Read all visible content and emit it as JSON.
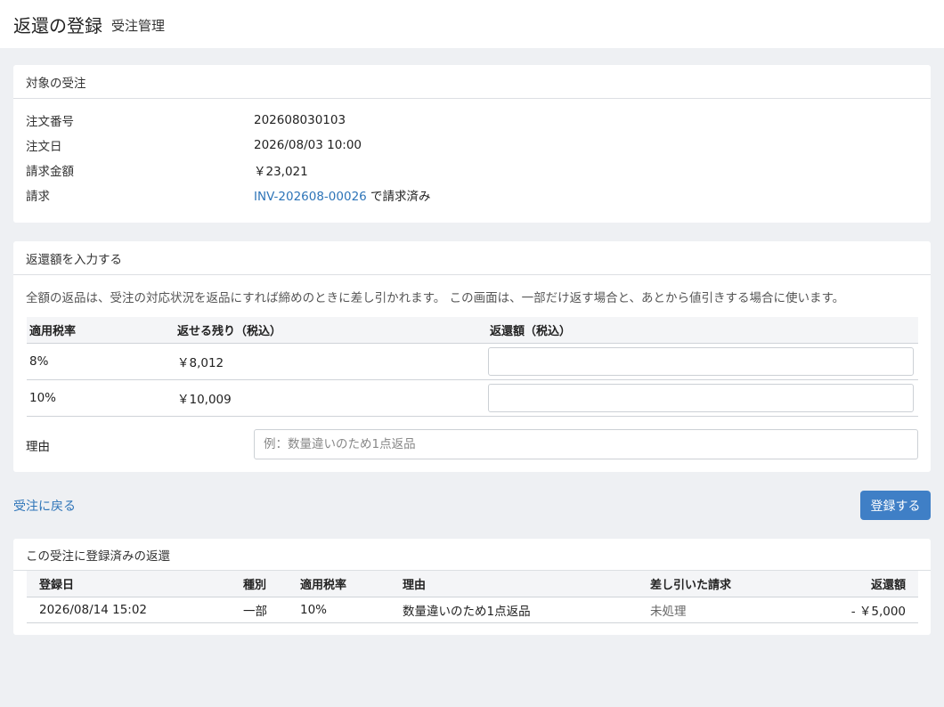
{
  "header": {
    "title": "返還の登録",
    "subtitle": "受注管理"
  },
  "target": {
    "heading": "対象の受注",
    "order_no_label": "注文番号",
    "order_no": "202608030103",
    "order_date_label": "注文日",
    "order_date": "2026/08/03 10:00",
    "amount_label": "請求金額",
    "amount": "￥23,021",
    "invoice_label": "請求",
    "invoice_no": "INV-202608-00026",
    "invoice_status": "で請求済み"
  },
  "entry": {
    "heading": "返還額を入力する",
    "note": "全額の返品は、受注の対応状況を返品にすれば締めのときに差し引かれます。 この画面は、一部だけ返す場合と、あとから値引きする場合に使います。",
    "columns": [
      "適用税率",
      "返せる残り（税込）",
      "返還額（税込）"
    ],
    "rows": [
      {
        "rate": "8%",
        "remaining": "￥8,012",
        "amount": ""
      },
      {
        "rate": "10%",
        "remaining": "￥10,009",
        "amount": ""
      }
    ],
    "reason_label": "理由",
    "reason_placeholder": "例：数量違いのため1点返品"
  },
  "actions": {
    "back": "受注に戻る",
    "submit": "登録する"
  },
  "registered": {
    "heading": "この受注に登録済みの返還",
    "columns": [
      "登録日",
      "種別",
      "適用税率",
      "理由",
      "差し引いた請求",
      "返還額"
    ],
    "rows": [
      {
        "date": "2026/08/14 15:02",
        "kind": "一部",
        "rate": "10%",
        "reason": "数量違いのため1点返品",
        "invoice": "未処理",
        "amount": "- ￥5,000"
      }
    ]
  }
}
